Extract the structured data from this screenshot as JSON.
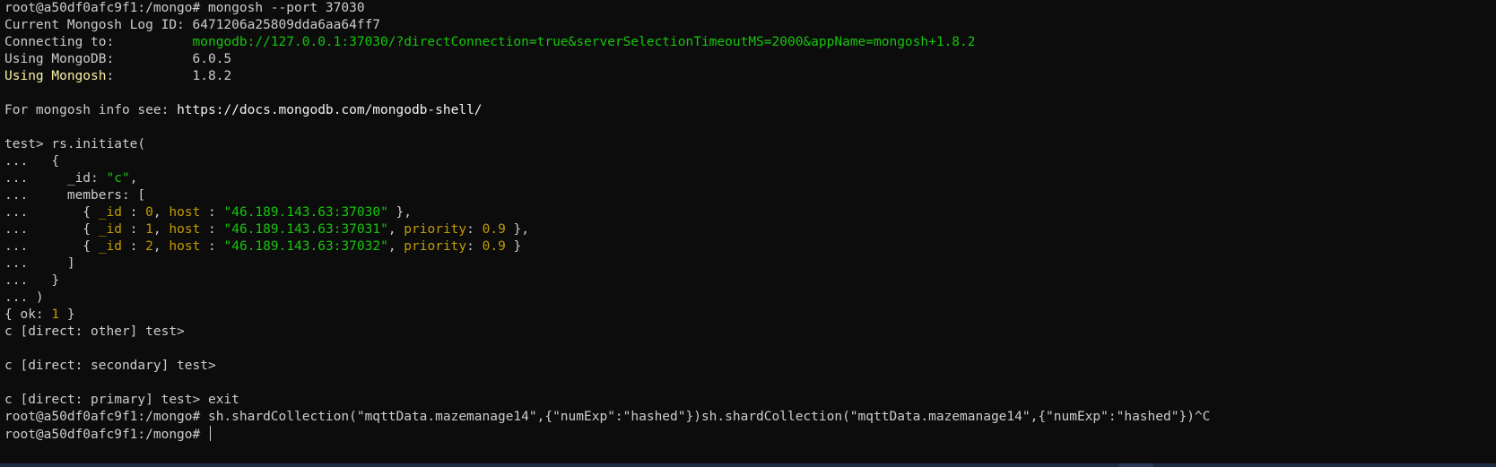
{
  "terminal": {
    "colors": {
      "background": "#0c0c0c",
      "text": "#cccccc",
      "green": "#16c60c",
      "yellow": "#c19c00",
      "light_yellow": "#f9f1a5",
      "bright": "#f2f2f2"
    },
    "lines": [
      {
        "segs": [
          {
            "t": "root@a50df0afc9f1:/mongo# mongosh --port 37030"
          }
        ]
      },
      {
        "segs": [
          {
            "t": "Current Mongosh Log ID: 6471206a25809dda6aa64ff7"
          }
        ]
      },
      {
        "segs": [
          {
            "t": "Connecting to:          "
          },
          {
            "t": "mongodb://127.0.0.1:37030/?directConnection=true&serverSelectionTimeoutMS=2000&appName=mongosh+1.8.2",
            "c": "green"
          }
        ]
      },
      {
        "segs": [
          {
            "t": "Using MongoDB:          6.0.5"
          }
        ]
      },
      {
        "segs": [
          {
            "t": "Using Mongosh",
            "c": "lyellow"
          },
          {
            "t": ":          1.8.2"
          }
        ]
      },
      {
        "segs": [
          {
            "t": ""
          }
        ]
      },
      {
        "segs": [
          {
            "t": "For mongosh info see: "
          },
          {
            "t": "https://docs.mongodb.com/mongodb-shell/",
            "c": "bright"
          }
        ]
      },
      {
        "segs": [
          {
            "t": ""
          }
        ]
      },
      {
        "segs": [
          {
            "t": "test> rs.initiate("
          }
        ]
      },
      {
        "segs": [
          {
            "t": "...   {"
          }
        ]
      },
      {
        "segs": [
          {
            "t": "...     _id: "
          },
          {
            "t": "\"c\"",
            "c": "green"
          },
          {
            "t": ","
          }
        ]
      },
      {
        "segs": [
          {
            "t": "...     members: ["
          }
        ]
      },
      {
        "segs": [
          {
            "t": "...       { "
          },
          {
            "t": "_id",
            "c": "yellow"
          },
          {
            "t": " : "
          },
          {
            "t": "0",
            "c": "yellow"
          },
          {
            "t": ", "
          },
          {
            "t": "host",
            "c": "yellow"
          },
          {
            "t": " : "
          },
          {
            "t": "\"46.189.143.63:37030\"",
            "c": "green"
          },
          {
            "t": " },"
          }
        ]
      },
      {
        "segs": [
          {
            "t": "...       { "
          },
          {
            "t": "_id",
            "c": "yellow"
          },
          {
            "t": " : "
          },
          {
            "t": "1",
            "c": "yellow"
          },
          {
            "t": ", "
          },
          {
            "t": "host",
            "c": "yellow"
          },
          {
            "t": " : "
          },
          {
            "t": "\"46.189.143.63:37031\"",
            "c": "green"
          },
          {
            "t": ", "
          },
          {
            "t": "priority",
            "c": "yellow"
          },
          {
            "t": ": "
          },
          {
            "t": "0.9",
            "c": "yellow"
          },
          {
            "t": " },"
          }
        ]
      },
      {
        "segs": [
          {
            "t": "...       { "
          },
          {
            "t": "_id",
            "c": "yellow"
          },
          {
            "t": " : "
          },
          {
            "t": "2",
            "c": "yellow"
          },
          {
            "t": ", "
          },
          {
            "t": "host",
            "c": "yellow"
          },
          {
            "t": " : "
          },
          {
            "t": "\"46.189.143.63:37032\"",
            "c": "green"
          },
          {
            "t": ", "
          },
          {
            "t": "priority",
            "c": "yellow"
          },
          {
            "t": ": "
          },
          {
            "t": "0.9",
            "c": "yellow"
          },
          {
            "t": " }"
          }
        ]
      },
      {
        "segs": [
          {
            "t": "...     ]"
          }
        ]
      },
      {
        "segs": [
          {
            "t": "...   }"
          }
        ]
      },
      {
        "segs": [
          {
            "t": "... )"
          }
        ]
      },
      {
        "segs": [
          {
            "t": "{ ok: "
          },
          {
            "t": "1",
            "c": "yellow"
          },
          {
            "t": " }"
          }
        ]
      },
      {
        "segs": [
          {
            "t": "c [direct: other] test>"
          }
        ]
      },
      {
        "segs": [
          {
            "t": ""
          }
        ]
      },
      {
        "segs": [
          {
            "t": "c [direct: secondary] test>"
          }
        ]
      },
      {
        "segs": [
          {
            "t": ""
          }
        ]
      },
      {
        "segs": [
          {
            "t": "c [direct: primary] test> exit"
          }
        ]
      },
      {
        "segs": [
          {
            "t": "root@a50df0afc9f1:/mongo# sh.shardCollection(\"mqttData.mazemanage14\",{\"numExp\":\"hashed\"})sh.shardCollection(\"mqttData.mazemanage14\",{\"numExp\":\"hashed\"})^C"
          }
        ]
      },
      {
        "segs": [
          {
            "t": "root@a50df0afc9f1:/mongo# "
          }
        ],
        "cursor": true
      }
    ]
  }
}
